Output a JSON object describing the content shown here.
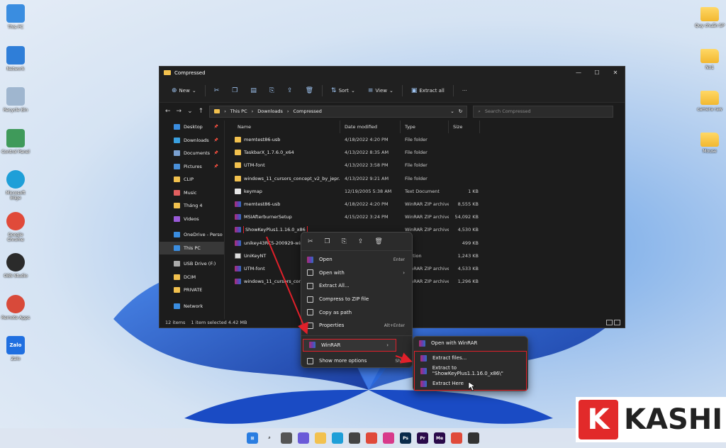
{
  "desktop_left": [
    {
      "label": "This PC",
      "icon": "monitor-icon",
      "color": "#3a8de0"
    },
    {
      "label": "Network",
      "icon": "network-icon",
      "color": "#2f7ed8"
    },
    {
      "label": "Recycle Bin",
      "icon": "recycle-bin-icon",
      "color": "#9fb6cf"
    },
    {
      "label": "Control Panel",
      "icon": "control-panel-icon",
      "color": "#3f9a5a"
    },
    {
      "label": "Microsoft Edge",
      "icon": "edge-icon",
      "color": "#1f9fd8"
    },
    {
      "label": "Google Chrome",
      "icon": "chrome-icon",
      "color": "#e04a3a"
    },
    {
      "label": "OBS Studio",
      "icon": "obs-icon",
      "color": "#2b2b2b"
    },
    {
      "label": "Remote Apps",
      "icon": "chrome-remote-icon",
      "color": "#d84a3a"
    },
    {
      "label": "Zalo",
      "icon": "zalo-icon",
      "color": "#1f6fe0",
      "glyph": "Zalo"
    }
  ],
  "desktop_right": [
    {
      "label": "Quy chuẩn SP",
      "icon": "folder-icon"
    },
    {
      "label": "No1",
      "icon": "folder-icon"
    },
    {
      "label": "camera raw",
      "icon": "folder-icon"
    },
    {
      "label": "Mouse",
      "icon": "folder-icon"
    }
  ],
  "window": {
    "title": "Compressed",
    "controls": {
      "minimize": "—",
      "maximize": "☐",
      "close": "✕"
    }
  },
  "toolbar": {
    "new_label": "New",
    "sort_label": "Sort",
    "view_label": "View",
    "extract_all_label": "Extract all",
    "more_label": "···"
  },
  "address": {
    "path": [
      "This PC",
      "Downloads",
      "Compressed"
    ],
    "search_placeholder": "Search Compressed"
  },
  "nav_pane": [
    {
      "label": "Desktop",
      "color": "#3a8de0",
      "pinned": true
    },
    {
      "label": "Downloads",
      "color": "#3aa0e0",
      "pinned": true
    },
    {
      "label": "Documents",
      "color": "#7aa0d0",
      "pinned": true
    },
    {
      "label": "Pictures",
      "color": "#4a90d9",
      "pinned": true
    },
    {
      "label": "CLIP",
      "color": "#f2c14e",
      "pinned": false
    },
    {
      "label": "Music",
      "color": "#e25f5f",
      "pinned": false
    },
    {
      "label": "Tháng 4",
      "color": "#f2c14e",
      "pinned": false
    },
    {
      "label": "Videos",
      "color": "#9a5ad8",
      "pinned": false
    },
    {
      "label": "",
      "color": "transparent",
      "pinned": false
    },
    {
      "label": "OneDrive - Perso",
      "color": "#3a8de0",
      "pinned": false
    },
    {
      "label": "This PC",
      "color": "#3a8de0",
      "pinned": false,
      "selected": true
    },
    {
      "label": "",
      "color": "transparent",
      "pinned": false
    },
    {
      "label": "USB Drive (F:)",
      "color": "#aaaaaa",
      "pinned": false
    },
    {
      "label": "DCIM",
      "color": "#f2c14e",
      "pinned": false
    },
    {
      "label": "PRIVATE",
      "color": "#f2c14e",
      "pinned": false
    },
    {
      "label": "",
      "color": "transparent",
      "pinned": false
    },
    {
      "label": "Network",
      "color": "#3a8de0",
      "pinned": false
    }
  ],
  "columns": {
    "name": "Name",
    "date": "Date modified",
    "type": "Type",
    "size": "Size"
  },
  "files": [
    {
      "name": "memtest86-usb",
      "date": "4/18/2022 4:20 PM",
      "type": "File folder",
      "size": "",
      "kind": "folder"
    },
    {
      "name": "TaskbarX_1.7.6.0_x64",
      "date": "4/13/2022 8:35 AM",
      "type": "File folder",
      "size": "",
      "kind": "folder"
    },
    {
      "name": "UTM-font",
      "date": "4/13/2022 3:58 PM",
      "type": "File folder",
      "size": "",
      "kind": "folder"
    },
    {
      "name": "windows_11_cursors_concept_v2_by_jepr...",
      "date": "4/13/2022 9:21 AM",
      "type": "File folder",
      "size": "",
      "kind": "folder"
    },
    {
      "name": "keymap",
      "date": "12/19/2005 5:38 AM",
      "type": "Text Document",
      "size": "1 KB",
      "kind": "txt"
    },
    {
      "name": "memtest86-usb",
      "date": "4/18/2022 4:20 PM",
      "type": "WinRAR ZIP archive",
      "size": "8,555 KB",
      "kind": "rar"
    },
    {
      "name": "MSIAfterburnerSetup",
      "date": "4/15/2022 3:24 PM",
      "type": "WinRAR ZIP archive",
      "size": "54,092 KB",
      "kind": "rar"
    },
    {
      "name": "ShowKeyPlus1.1.16.0_x86",
      "date": "",
      "type": "WinRAR ZIP archive",
      "size": "4,530 KB",
      "kind": "rar",
      "highlight": true
    },
    {
      "name": "unikey43RC5-200929-win64",
      "date": "",
      "type": "",
      "size": "499 KB",
      "kind": "rar"
    },
    {
      "name": "UniKeyNT",
      "date": "",
      "type": "lication",
      "size": "1,243 KB",
      "kind": "exe"
    },
    {
      "name": "UTM-font",
      "date": "",
      "type": "WinRAR ZIP archive",
      "size": "4,533 KB",
      "kind": "rar"
    },
    {
      "name": "windows_11_cursors_concept",
      "date": "",
      "type": "WinRAR ZIP archive",
      "size": "1,296 KB",
      "kind": "rar"
    }
  ],
  "status": {
    "count": "12 items",
    "selected": "1 item selected  4.42 MB"
  },
  "context_menu": {
    "items": [
      {
        "label": "Open",
        "shortcut": "Enter",
        "icon": "winrar"
      },
      {
        "label": "Open with",
        "shortcut": "",
        "icon": "plain",
        "submenu": true
      },
      {
        "label": "Extract All...",
        "shortcut": "",
        "icon": "plain"
      },
      {
        "label": "Compress to ZIP file",
        "shortcut": "",
        "icon": "plain"
      },
      {
        "label": "Copy as path",
        "shortcut": "",
        "icon": "plain"
      },
      {
        "label": "Properties",
        "shortcut": "Alt+Enter",
        "icon": "plain"
      }
    ],
    "winrar_label": "WinRAR",
    "more_label": "Show more options",
    "more_shortcut": "Shift"
  },
  "winrar_submenu": {
    "open_label": "Open with WinRAR",
    "items": [
      "Extract files...",
      "Extract to \"ShowKeyPlus1.1.16.0_x86\\\"",
      "Extract Here"
    ]
  },
  "watermark": {
    "badge": "K",
    "text": "KASHI"
  },
  "colors": {
    "highlight": "#e0202a",
    "window_bg": "#1c1c1c",
    "menu_bg": "#2b2b2b"
  }
}
